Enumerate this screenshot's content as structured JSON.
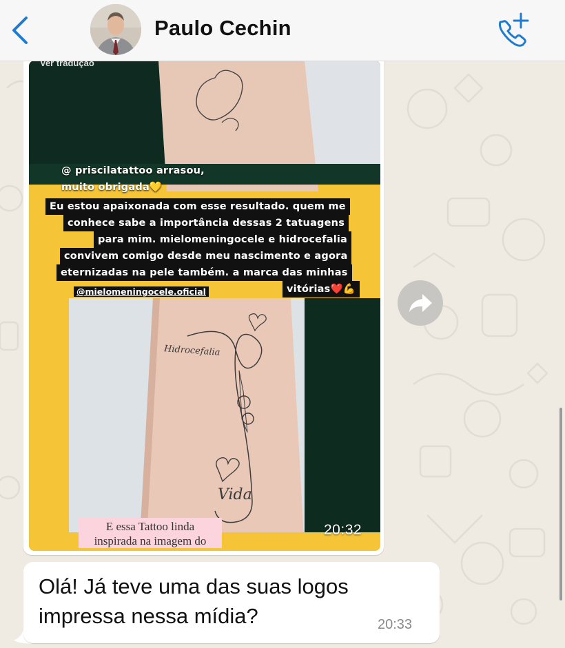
{
  "header": {
    "contact_name": "Paulo Cechin",
    "back_icon": "chevron-left-icon",
    "call_icon": "add-call-icon",
    "accent_color": "#1f7bd0"
  },
  "image_message": {
    "view_translation": "Ver tradução",
    "story_lines": [
      "@ priscilatattoo arrasou,",
      "muito obrigada💛",
      "Eu estou apaixonada com esse resultado. quem me",
      "conhece sabe a importância dessas 2 tatuagens",
      "para mim. mielomeningocele e hidrocefalia",
      "convivem comigo desde meu nascimento e agora",
      "eternizadas na pele também. a marca das minhas",
      "vitórias❤️💪"
    ],
    "mention": "@mielomeningocele.oficial",
    "tattoo_word_top": "Hidrocefalia",
    "tattoo_word_bottom": "Vida",
    "caption_line1": "E essa Tattoo linda",
    "caption_line2": "inspirada na imagem do",
    "time": "20:32"
  },
  "forward_icon": "forward-icon",
  "text_message": {
    "line1": "Olá! Já teve uma das suas logos",
    "line2": "impressa nessa mídia?",
    "time": "20:33"
  }
}
